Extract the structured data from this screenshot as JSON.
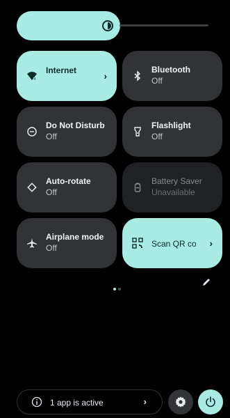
{
  "brightness": {
    "level": 0.45
  },
  "tiles": [
    {
      "id": "internet",
      "title": "Internet",
      "subtitle": "",
      "icon": "wifi-icon",
      "state": "active",
      "has_chevron": true
    },
    {
      "id": "bluetooth",
      "title": "Bluetooth",
      "subtitle": "Off",
      "icon": "bluetooth-icon",
      "state": "inactive",
      "has_chevron": false
    },
    {
      "id": "dnd",
      "title": "Do Not Disturb",
      "subtitle": "Off",
      "icon": "do-not-disturb-icon",
      "state": "inactive",
      "has_chevron": false
    },
    {
      "id": "flashlight",
      "title": "Flashlight",
      "subtitle": "Off",
      "icon": "flashlight-icon",
      "state": "inactive",
      "has_chevron": false
    },
    {
      "id": "autorotate",
      "title": "Auto-rotate",
      "subtitle": "Off",
      "icon": "rotate-icon",
      "state": "inactive",
      "has_chevron": false
    },
    {
      "id": "battery-saver",
      "title": "Battery Saver",
      "subtitle": "Unavailable",
      "icon": "battery-icon",
      "state": "unavailable",
      "has_chevron": false
    },
    {
      "id": "airplane",
      "title": "Airplane mode",
      "subtitle": "Off",
      "icon": "airplane-icon",
      "state": "inactive",
      "has_chevron": false
    },
    {
      "id": "scan-qr",
      "title": "Scan QR code",
      "subtitle": "",
      "icon": "qr-code-icon",
      "state": "active",
      "has_chevron": true
    }
  ],
  "pager": {
    "pages": 2,
    "current": 1
  },
  "footer": {
    "active_apps_text": "1 app is active",
    "info_icon": "info-icon",
    "settings_icon": "gear-icon",
    "power_icon": "power-icon"
  },
  "colors": {
    "accent": "#a7ebe2",
    "tile_inactive": "#313336",
    "tile_unavailable": "#1f2123",
    "background": "#000000"
  }
}
